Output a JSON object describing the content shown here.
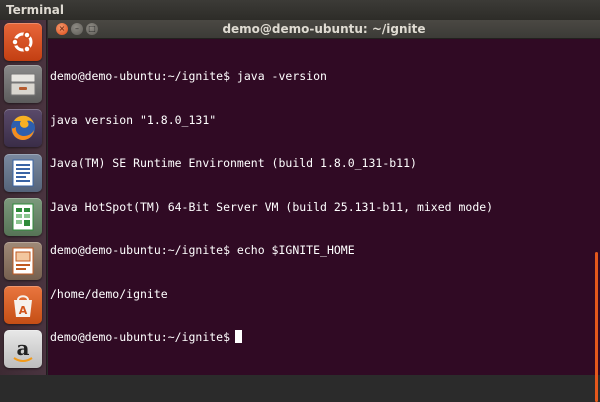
{
  "top_panel": {
    "title": "Terminal"
  },
  "window": {
    "title": "demo@demo-ubuntu: ~/ignite",
    "buttons": {
      "close": "×",
      "minimize": "–",
      "maximize": "□"
    }
  },
  "terminal": {
    "lines": [
      "demo@demo-ubuntu:~/ignite$ java -version",
      "java version \"1.8.0_131\"",
      "Java(TM) SE Runtime Environment (build 1.8.0_131-b11)",
      "Java HotSpot(TM) 64-Bit Server VM (build 25.131-b11, mixed mode)",
      "demo@demo-ubuntu:~/ignite$ echo $IGNITE_HOME",
      "/home/demo/ignite",
      "demo@demo-ubuntu:~/ignite$"
    ]
  },
  "launcher": {
    "items": [
      {
        "name": "ubuntu-dash-icon"
      },
      {
        "name": "files-icon"
      },
      {
        "name": "firefox-icon"
      },
      {
        "name": "libreoffice-writer-icon"
      },
      {
        "name": "libreoffice-calc-icon"
      },
      {
        "name": "libreoffice-impress-icon"
      },
      {
        "name": "ubuntu-software-icon"
      },
      {
        "name": "amazon-icon"
      }
    ]
  },
  "colors": {
    "terminal_bg": "#300a24",
    "accent": "#e4581c"
  }
}
